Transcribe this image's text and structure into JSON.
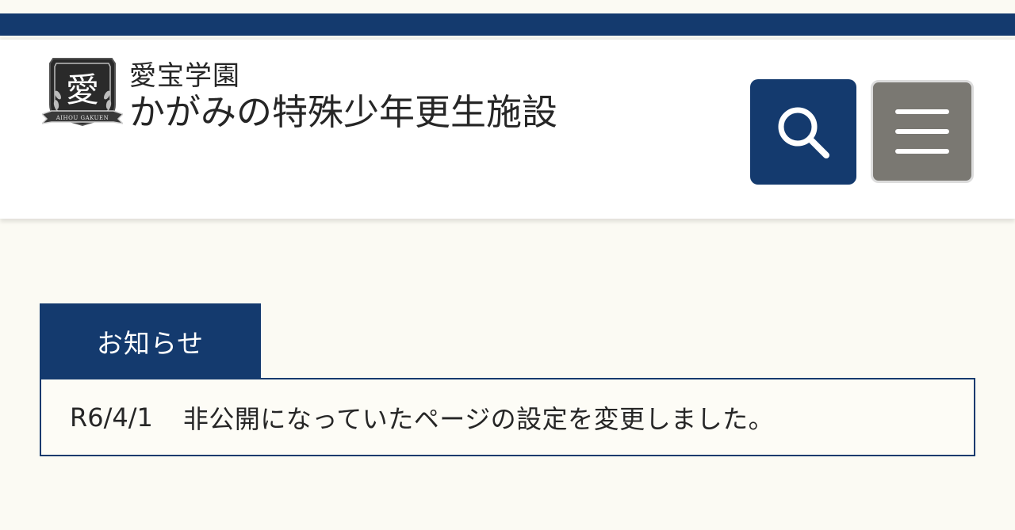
{
  "header": {
    "org_name": "愛宝学園",
    "facility_name": "かがみの特殊少年更生施設",
    "logo": {
      "emblem_char": "愛",
      "ribbon_text": "AIHOU GAKUEN"
    },
    "search_icon": "search-icon",
    "menu_icon": "hamburger-menu-icon"
  },
  "colors": {
    "primary": "#143a6e",
    "menu_button": "#7a7872",
    "page_background": "#fbfaf3"
  },
  "news": {
    "tab_label": "お知らせ",
    "items": [
      {
        "date": "R6/4/1",
        "text": "非公開になっていたページの設定を変更しました。"
      }
    ]
  }
}
